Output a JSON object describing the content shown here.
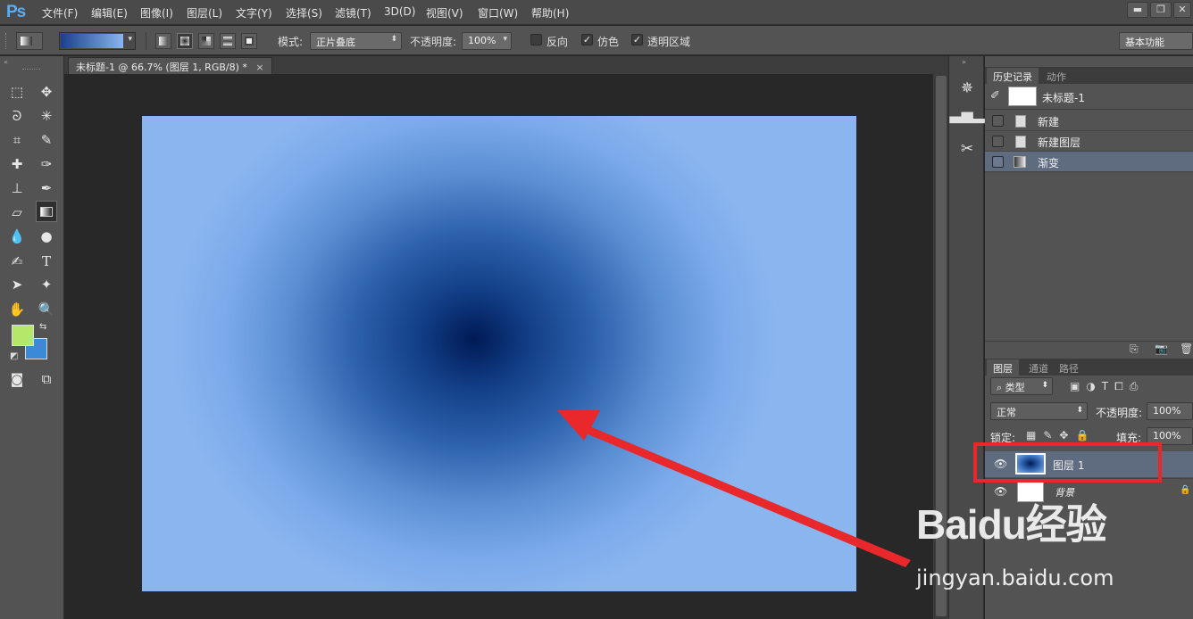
{
  "app": {
    "logo": "Ps"
  },
  "menu": {
    "items": [
      "文件(F)",
      "编辑(E)",
      "图像(I)",
      "图层(L)",
      "文字(Y)",
      "选择(S)",
      "滤镜(T)",
      "3D(D)",
      "视图(V)",
      "窗口(W)",
      "帮助(H)"
    ]
  },
  "window_controls": {
    "minimize": "▬",
    "restore": "❐",
    "close": "✕"
  },
  "options": {
    "mode_label": "模式:",
    "mode_value": "正片叠底",
    "opacity_label": "不透明度:",
    "opacity_value": "100%",
    "reverse_label": "反向",
    "reverse_checked": false,
    "dither_label": "仿色",
    "dither_checked": true,
    "transparency_label": "透明区域",
    "transparency_checked": true,
    "workspace": "基本功能",
    "gradient_colors": [
      "#1c3f8a",
      "#8ab5ef"
    ]
  },
  "document": {
    "tab_title": "未标题-1 @ 66.7% (图层 1, RGB/8) *",
    "close": "×"
  },
  "canvas": {
    "gradient_type": "radial",
    "center_color": "#001a55",
    "edge_color": "#8ab5ef"
  },
  "colors": {
    "foreground": "#b5e86a",
    "background": "#3a8ad8"
  },
  "history": {
    "tabs": [
      "历史记录",
      "动作"
    ],
    "snapshot": "未标题-1",
    "items": [
      {
        "label": "新建",
        "selected": false
      },
      {
        "label": "新建图层",
        "selected": false
      },
      {
        "label": "渐变",
        "selected": true
      }
    ]
  },
  "layers": {
    "tabs": [
      "图层",
      "通道",
      "路径"
    ],
    "filter_kind": "类型",
    "blend_mode": "正常",
    "opacity_label": "不透明度:",
    "opacity_value": "100%",
    "lock_label": "锁定:",
    "fill_label": "填充:",
    "fill_value": "100%",
    "items": [
      {
        "name": "图层 1",
        "selected": true
      },
      {
        "name": "背景",
        "selected": false,
        "locked": true
      }
    ]
  },
  "watermark": {
    "logo": "Baidu经验",
    "url": "jingyan.baidu.com"
  },
  "annotation": {
    "color": "#e8282b"
  }
}
